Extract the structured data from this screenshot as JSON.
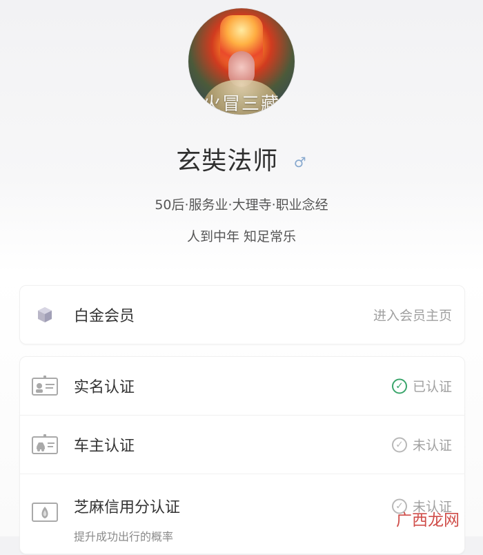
{
  "profile": {
    "avatar_caption": "火冒三藏",
    "name": "玄奘法师",
    "gender_symbol": "♂",
    "meta_line": "50后·服务业·大理寺·职业念经",
    "motto": "人到中年 知足常乐"
  },
  "membership": {
    "icon": "diamond-icon",
    "label": "白金会员",
    "action": "进入会员主页"
  },
  "verifications": [
    {
      "icon": "id-card-icon",
      "label": "实名认证",
      "status": "已认证",
      "verified": true
    },
    {
      "icon": "car-card-icon",
      "label": "车主认证",
      "status": "未认证",
      "verified": false
    },
    {
      "icon": "sesame-credit-icon",
      "label": "芝麻信用分认证",
      "subtitle": "提升成功出行的概率",
      "status": "未认证",
      "verified": false
    }
  ],
  "watermark": "广西龙网",
  "colors": {
    "verified_green": "#3aa56b",
    "gender_blue": "#88a9cf",
    "watermark_red": "#cc3e3a"
  }
}
